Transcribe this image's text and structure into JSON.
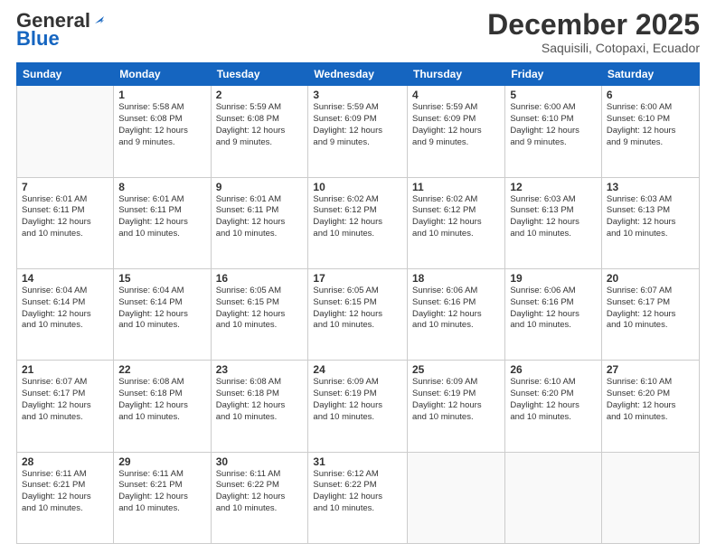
{
  "logo": {
    "general": "General",
    "blue": "Blue"
  },
  "header": {
    "month": "December 2025",
    "location": "Saquisili, Cotopaxi, Ecuador"
  },
  "weekdays": [
    "Sunday",
    "Monday",
    "Tuesday",
    "Wednesday",
    "Thursday",
    "Friday",
    "Saturday"
  ],
  "weeks": [
    [
      {
        "day": "",
        "info": ""
      },
      {
        "day": "1",
        "info": "Sunrise: 5:58 AM\nSunset: 6:08 PM\nDaylight: 12 hours\nand 9 minutes."
      },
      {
        "day": "2",
        "info": "Sunrise: 5:59 AM\nSunset: 6:08 PM\nDaylight: 12 hours\nand 9 minutes."
      },
      {
        "day": "3",
        "info": "Sunrise: 5:59 AM\nSunset: 6:09 PM\nDaylight: 12 hours\nand 9 minutes."
      },
      {
        "day": "4",
        "info": "Sunrise: 5:59 AM\nSunset: 6:09 PM\nDaylight: 12 hours\nand 9 minutes."
      },
      {
        "day": "5",
        "info": "Sunrise: 6:00 AM\nSunset: 6:10 PM\nDaylight: 12 hours\nand 9 minutes."
      },
      {
        "day": "6",
        "info": "Sunrise: 6:00 AM\nSunset: 6:10 PM\nDaylight: 12 hours\nand 9 minutes."
      }
    ],
    [
      {
        "day": "7",
        "info": ""
      },
      {
        "day": "8",
        "info": "Sunrise: 6:01 AM\nSunset: 6:11 PM\nDaylight: 12 hours\nand 10 minutes."
      },
      {
        "day": "9",
        "info": "Sunrise: 6:01 AM\nSunset: 6:11 PM\nDaylight: 12 hours\nand 10 minutes."
      },
      {
        "day": "10",
        "info": "Sunrise: 6:02 AM\nSunset: 6:12 PM\nDaylight: 12 hours\nand 10 minutes."
      },
      {
        "day": "11",
        "info": "Sunrise: 6:02 AM\nSunset: 6:12 PM\nDaylight: 12 hours\nand 10 minutes."
      },
      {
        "day": "12",
        "info": "Sunrise: 6:03 AM\nSunset: 6:13 PM\nDaylight: 12 hours\nand 10 minutes."
      },
      {
        "day": "13",
        "info": "Sunrise: 6:03 AM\nSunset: 6:13 PM\nDaylight: 12 hours\nand 10 minutes."
      }
    ],
    [
      {
        "day": "14",
        "info": ""
      },
      {
        "day": "15",
        "info": "Sunrise: 6:04 AM\nSunset: 6:14 PM\nDaylight: 12 hours\nand 10 minutes."
      },
      {
        "day": "16",
        "info": "Sunrise: 6:05 AM\nSunset: 6:15 PM\nDaylight: 12 hours\nand 10 minutes."
      },
      {
        "day": "17",
        "info": "Sunrise: 6:05 AM\nSunset: 6:15 PM\nDaylight: 12 hours\nand 10 minutes."
      },
      {
        "day": "18",
        "info": "Sunrise: 6:06 AM\nSunset: 6:16 PM\nDaylight: 12 hours\nand 10 minutes."
      },
      {
        "day": "19",
        "info": "Sunrise: 6:06 AM\nSunset: 6:16 PM\nDaylight: 12 hours\nand 10 minutes."
      },
      {
        "day": "20",
        "info": "Sunrise: 6:07 AM\nSunset: 6:17 PM\nDaylight: 12 hours\nand 10 minutes."
      }
    ],
    [
      {
        "day": "21",
        "info": ""
      },
      {
        "day": "22",
        "info": "Sunrise: 6:08 AM\nSunset: 6:18 PM\nDaylight: 12 hours\nand 10 minutes."
      },
      {
        "day": "23",
        "info": "Sunrise: 6:08 AM\nSunset: 6:18 PM\nDaylight: 12 hours\nand 10 minutes."
      },
      {
        "day": "24",
        "info": "Sunrise: 6:09 AM\nSunset: 6:19 PM\nDaylight: 12 hours\nand 10 minutes."
      },
      {
        "day": "25",
        "info": "Sunrise: 6:09 AM\nSunset: 6:19 PM\nDaylight: 12 hours\nand 10 minutes."
      },
      {
        "day": "26",
        "info": "Sunrise: 6:10 AM\nSunset: 6:20 PM\nDaylight: 12 hours\nand 10 minutes."
      },
      {
        "day": "27",
        "info": "Sunrise: 6:10 AM\nSunset: 6:20 PM\nDaylight: 12 hours\nand 10 minutes."
      }
    ],
    [
      {
        "day": "28",
        "info": "Sunrise: 6:11 AM\nSunset: 6:21 PM\nDaylight: 12 hours\nand 10 minutes."
      },
      {
        "day": "29",
        "info": "Sunrise: 6:11 AM\nSunset: 6:21 PM\nDaylight: 12 hours\nand 10 minutes."
      },
      {
        "day": "30",
        "info": "Sunrise: 6:11 AM\nSunset: 6:22 PM\nDaylight: 12 hours\nand 10 minutes."
      },
      {
        "day": "31",
        "info": "Sunrise: 6:12 AM\nSunset: 6:22 PM\nDaylight: 12 hours\nand 10 minutes."
      },
      {
        "day": "",
        "info": ""
      },
      {
        "day": "",
        "info": ""
      },
      {
        "day": "",
        "info": ""
      }
    ]
  ],
  "week1_sun_info": "Sunrise: 6:01 AM\nSunset: 6:11 PM\nDaylight: 12 hours\nand 10 minutes.",
  "week2_sun_info": "Sunrise: 6:04 AM\nSunset: 6:14 PM\nDaylight: 12 hours\nand 10 minutes.",
  "week3_sun_info": "Sunrise: 6:07 AM\nSunset: 6:17 PM\nDaylight: 12 hours\nand 10 minutes.",
  "week4_sun_info": "Sunrise: 6:07 AM\nSunset: 6:17 PM\nDaylight: 12 hours\nand 10 minutes."
}
